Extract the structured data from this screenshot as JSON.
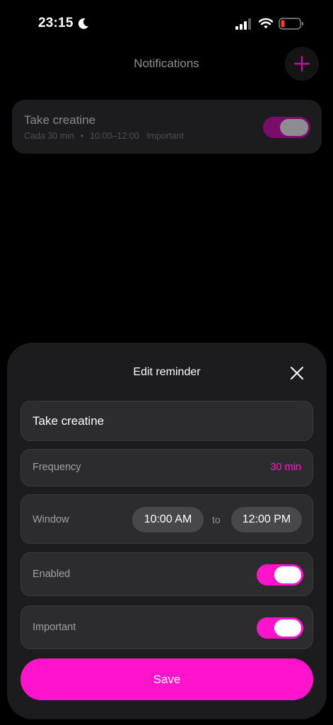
{
  "status_bar": {
    "time": "23:15"
  },
  "header": {
    "title": "Notifications",
    "add_icon": "plus-icon"
  },
  "reminder_card": {
    "title": "Take creatine",
    "frequency": "Cada 30 min",
    "separator": "•",
    "window": "10:00–12:00",
    "priority": "Important",
    "enabled": true
  },
  "sheet": {
    "title": "Edit reminder",
    "close_icon": "close-icon",
    "name_value": "Take creatine",
    "frequency_label": "Frequency",
    "frequency_value": "30 min",
    "window_label": "Window",
    "window_start": "10:00 AM",
    "window_to": "to",
    "window_end": "12:00 PM",
    "enabled_label": "Enabled",
    "enabled": true,
    "important_label": "Important",
    "important": true,
    "save_label": "Save"
  },
  "colors": {
    "accent": "#ff14cc",
    "background": "#000000",
    "card": "#1c1c1e",
    "field": "#2c2c2e"
  }
}
